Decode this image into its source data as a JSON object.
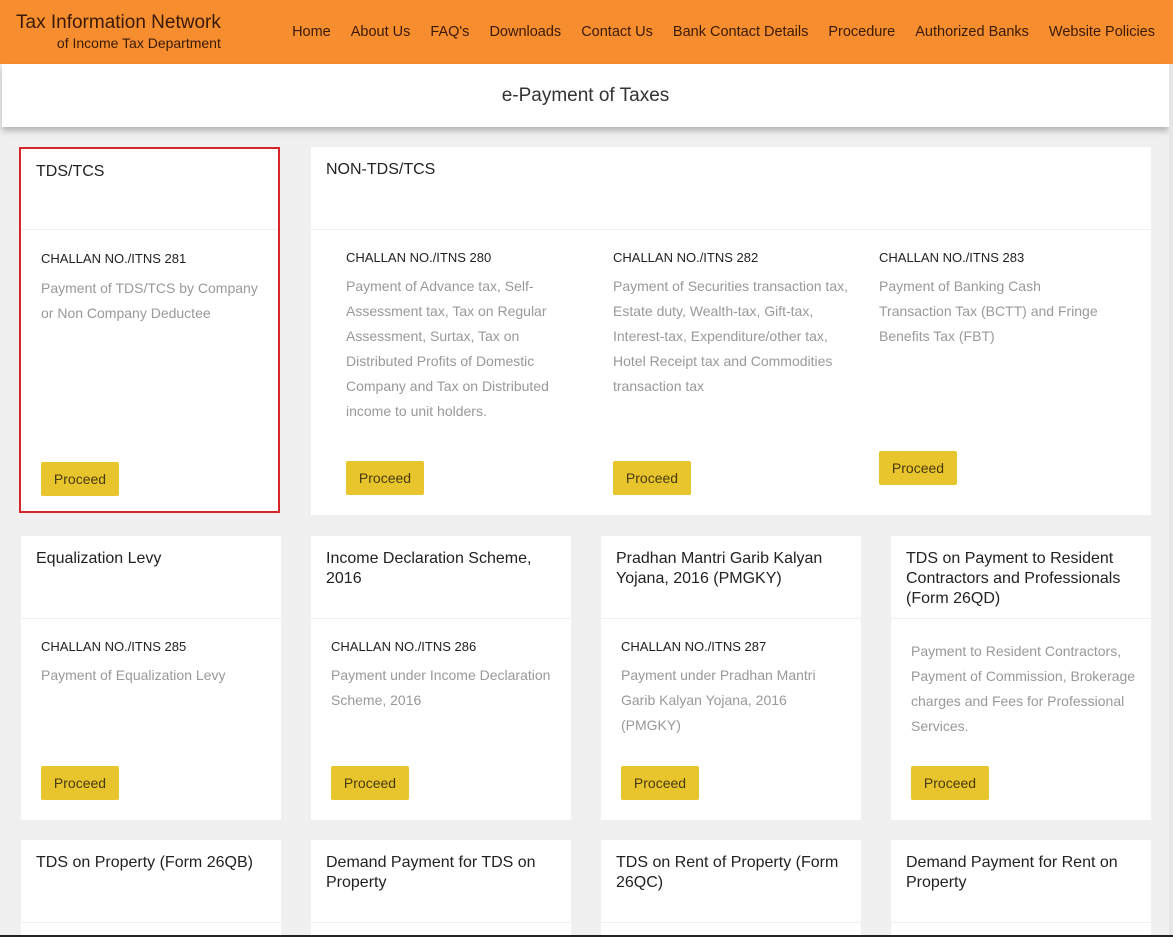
{
  "header": {
    "brand_title": "Tax Information Network",
    "brand_subtitle": "of Income Tax Department",
    "nav": [
      "Home",
      "About Us",
      "FAQ's",
      "Downloads",
      "Contact Us",
      "Bank Contact Details",
      "Procedure",
      "Authorized Banks",
      "Website Policies"
    ],
    "color": "#f68e2f"
  },
  "page_title": "e-Payment of Taxes",
  "proceed_label": "Proceed",
  "cards": {
    "tds_tcs": {
      "title": "TDS/TCS",
      "selected": true,
      "challan": "CHALLAN NO./ITNS 281",
      "desc": "Payment of TDS/TCS by Company or Non Company Deductee"
    },
    "non_tds_tcs": {
      "title": "NON-TDS/TCS",
      "items": [
        {
          "challan": "CHALLAN NO./ITNS 280",
          "desc": "Payment of Advance tax, Self-Assessment tax, Tax on Regular Assessment, Surtax, Tax on Distributed Profits of Domestic Company and Tax on Distributed income to unit holders."
        },
        {
          "challan": "CHALLAN NO./ITNS 282",
          "desc": "Payment of Securities transaction tax, Estate duty, Wealth-tax, Gift-tax, Interest-tax, Expenditure/other tax, Hotel Receipt tax and Commodities transaction tax"
        },
        {
          "challan": "CHALLAN NO./ITNS 283",
          "desc": "Payment of Banking Cash Transaction Tax (BCTT) and Fringe Benefits Tax (FBT)"
        }
      ]
    },
    "row2": [
      {
        "title": "Equalization Levy",
        "challan": "CHALLAN NO./ITNS 285",
        "desc": "Payment of Equalization Levy"
      },
      {
        "title": "Income Declaration Scheme, 2016",
        "challan": "CHALLAN NO./ITNS 286",
        "desc": "Payment under Income Declaration Scheme, 2016"
      },
      {
        "title": "Pradhan Mantri Garib Kalyan Yojana, 2016 (PMGKY)",
        "challan": "CHALLAN NO./ITNS 287",
        "desc": "Payment under Pradhan Mantri Garib Kalyan Yojana, 2016 (PMGKY)"
      },
      {
        "title": "TDS on Payment to Resident Contractors and Professionals (Form 26QD)",
        "challan": "",
        "desc": "Payment to Resident Contractors, Payment of Commission, Brokerage charges and Fees for Professional Services."
      }
    ],
    "row3": [
      {
        "title": "TDS on Property (Form 26QB)"
      },
      {
        "title": "Demand Payment for TDS on Property"
      },
      {
        "title": "TDS on Rent of Property (Form 26QC)"
      },
      {
        "title": "Demand Payment for Rent on Property"
      }
    ]
  }
}
